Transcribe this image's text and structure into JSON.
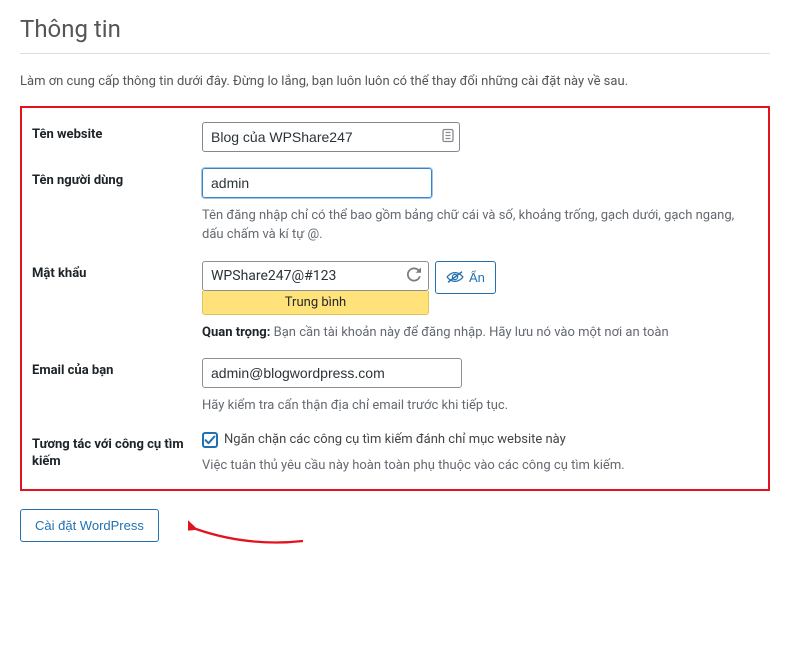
{
  "heading": "Thông tin",
  "intro": "Làm ơn cung cấp thông tin dưới đây. Đừng lo lắng, bạn luôn luôn có thể thay đổi những cài đặt này về sau.",
  "fields": {
    "site_title": {
      "label": "Tên website",
      "value": "Blog của WPShare247"
    },
    "username": {
      "label": "Tên người dùng",
      "value": "admin",
      "hint": "Tên đăng nhập chỉ có thể bao gồm bảng chữ cái và số, khoảng trống, gạch dưới, gạch ngang, dấu chấm và kí tự @."
    },
    "password": {
      "label": "Mật khẩu",
      "value": "WPShare247@#123",
      "strength": "Trung bình",
      "hide_btn": "Ẩn",
      "important_label": "Quan trọng:",
      "important_text": " Bạn cần tài khoản này để đăng nhập. Hãy lưu nó vào một nơi an toàn"
    },
    "email": {
      "label": "Email của bạn",
      "value": "admin@blogwordpress.com",
      "hint": "Hãy kiểm tra cẩn thận địa chỉ email trước khi tiếp tục."
    },
    "search_engine": {
      "label": "Tương tác với công cụ tìm kiếm",
      "checkbox_label": "Ngăn chặn các công cụ tìm kiếm đánh chỉ mục website này",
      "hint": "Việc tuân thủ yêu cầu này hoàn toàn phụ thuộc vào các công cụ tìm kiếm."
    }
  },
  "submit_label": "Cài đặt WordPress"
}
